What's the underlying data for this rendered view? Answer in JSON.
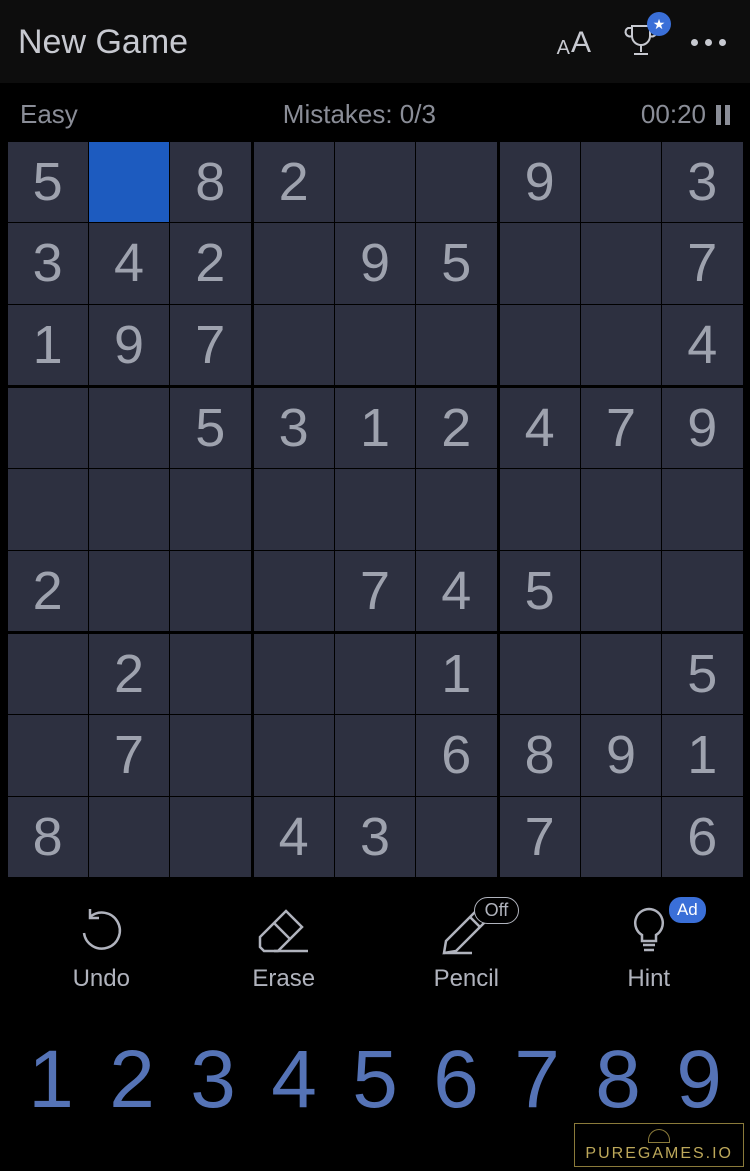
{
  "header": {
    "title": "New Game"
  },
  "status": {
    "difficulty": "Easy",
    "mistakes_label": "Mistakes: 0/3",
    "timer": "00:20"
  },
  "board": {
    "selected": [
      0,
      1
    ],
    "grid": [
      [
        "5",
        "",
        "8",
        "2",
        "",
        "",
        "9",
        "",
        "3"
      ],
      [
        "3",
        "4",
        "2",
        "",
        "9",
        "5",
        "",
        "",
        "7"
      ],
      [
        "1",
        "9",
        "7",
        "",
        "",
        "",
        "",
        "",
        "4"
      ],
      [
        "",
        "",
        "5",
        "3",
        "1",
        "2",
        "4",
        "7",
        "9"
      ],
      [
        "",
        "",
        "",
        "",
        "",
        "",
        "",
        "",
        ""
      ],
      [
        "2",
        "",
        "",
        "",
        "7",
        "4",
        "5",
        "",
        ""
      ],
      [
        "",
        "2",
        "",
        "",
        "",
        "1",
        "",
        "",
        "5"
      ],
      [
        "",
        "7",
        "",
        "",
        "",
        "6",
        "8",
        "9",
        "1"
      ],
      [
        "8",
        "",
        "",
        "4",
        "3",
        "",
        "7",
        "",
        "6"
      ]
    ]
  },
  "actions": {
    "undo": "Undo",
    "erase": "Erase",
    "pencil": "Pencil",
    "pencil_state": "Off",
    "hint": "Hint",
    "hint_badge": "Ad"
  },
  "numpad": [
    "1",
    "2",
    "3",
    "4",
    "5",
    "6",
    "7",
    "8",
    "9"
  ],
  "watermark": "PUREGAMES.IO"
}
